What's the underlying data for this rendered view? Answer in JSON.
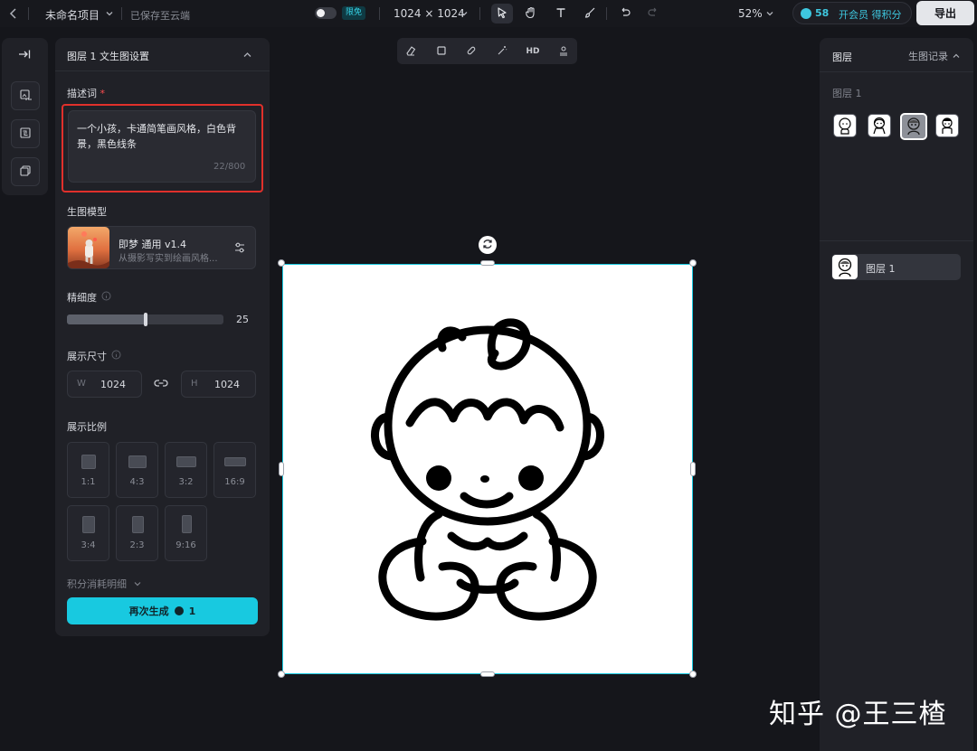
{
  "topbar": {
    "project_name": "未命名项目",
    "save_status": "已保存至云端",
    "free_badge": "限免",
    "canvas_size": "1024 × 1024",
    "zoom": "52%",
    "credits": "58",
    "vip_label": "开会员 得积分",
    "export_label": "导出"
  },
  "left_panel": {
    "title": "图层 1 文生图设置",
    "prompt_label": "描述词",
    "prompt_text": "一个小孩，卡通简笔画风格，白色背景，黑色线条",
    "prompt_count": "22/800",
    "model_label": "生图模型",
    "model_name": "即梦 通用 v1.4",
    "model_desc": "从摄影写实到绘画风格...",
    "detail_label": "精细度",
    "detail_value": 25,
    "detail_value_text": "25",
    "detail_max": 50,
    "size_label": "展示尺寸",
    "width_prefix": "W",
    "width_value": "1024",
    "height_prefix": "H",
    "height_value": "1024",
    "ratio_label": "展示比例",
    "ratios": [
      "1:1",
      "4:3",
      "3:2",
      "16:9",
      "3:4",
      "2:3",
      "9:16"
    ],
    "cost_label": "积分消耗明细",
    "generate_label": "再次生成",
    "generate_cost": "1"
  },
  "canvas_toolbar": {
    "hd_label": "HD"
  },
  "right_panel": {
    "title": "图层",
    "history_label": "生图记录",
    "layer_group_label": "图层 1",
    "layer_item_label": "图层 1"
  },
  "watermark": "知乎 @王三楂",
  "colors": {
    "accent": "#18c9e0",
    "highlight_frame": "#e0302b",
    "background": "#15161b",
    "panel": "#202127"
  }
}
